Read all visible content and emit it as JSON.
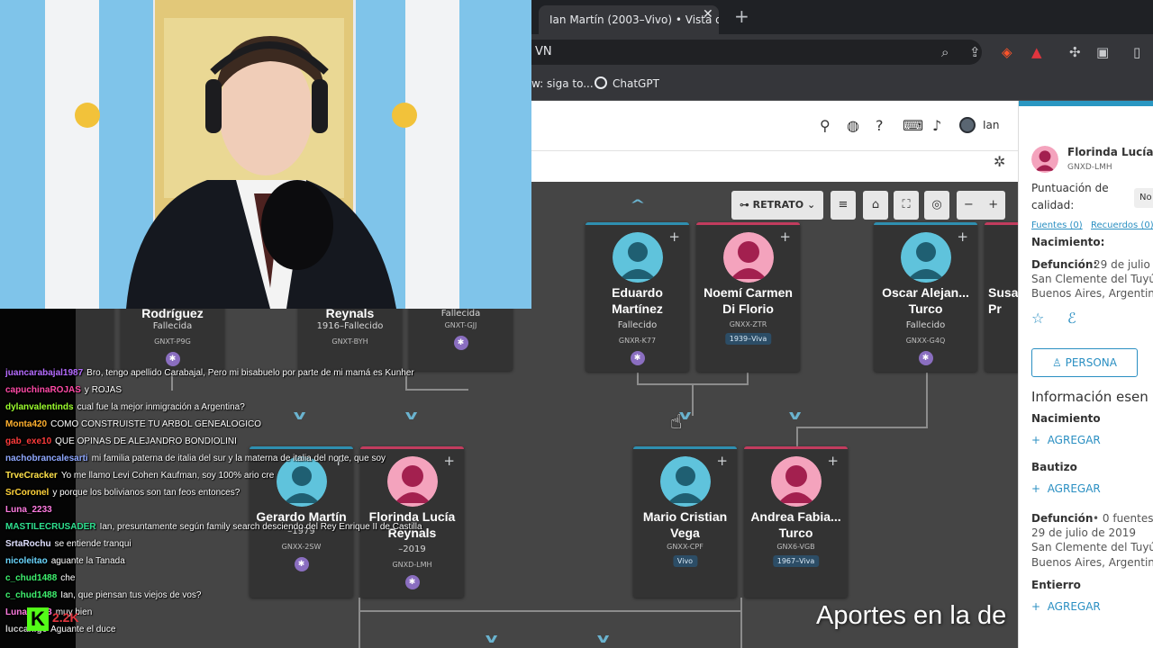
{
  "browser": {
    "tab_title": "Ian Martín (2003–Vivo) • Vista de",
    "tab_close": "✕",
    "new_tab": "+",
    "url_fragment": "VN",
    "bookmarks": [
      "w: siga to...",
      "ChatGPT"
    ]
  },
  "site_header": {
    "user_name": "Ian"
  },
  "tree": {
    "view_mode": "RETRATO",
    "top_row": [
      {
        "name": "Eduardo Martínez",
        "status": "Fallecido",
        "id": "GNXR-K77",
        "gender": "male"
      },
      {
        "name": "Noemí Carmen Di Florio",
        "id": "GNXX-ZTR",
        "badge": "1939–Viva",
        "gender": "female"
      },
      {
        "name": "Oscar Alejan... Turco",
        "status": "Fallecido",
        "id": "GNXX-G4Q",
        "gender": "male"
      },
      {
        "name": "Susa... Pr",
        "gender": "female"
      }
    ],
    "top_row_partial": [
      {
        "name": "Rodríguez",
        "status": "Fallecida",
        "id": "GNXT-P9G"
      },
      {
        "name": "Reynals",
        "status": "1916–Fallecido",
        "id": "GNXT-BYH"
      },
      {
        "status": "Fallecida",
        "id": "GNXT-GJJ"
      }
    ],
    "mid_row": [
      {
        "name": "Gerardo Martín",
        "dates": "–1979",
        "id": "GNXX-2SW",
        "gender": "male"
      },
      {
        "name": "Florinda Lucía Reynals",
        "dates": "–2019",
        "id": "GNXD-LMH",
        "gender": "female"
      },
      {
        "name": "Mario Cristian Vega",
        "id": "GNXX-CPF",
        "badge": "Vivo",
        "gender": "male"
      },
      {
        "name": "Andrea Fabia... Turco",
        "id": "GNX6-VGB",
        "badge": "1967–Viva",
        "gender": "female"
      }
    ]
  },
  "panel": {
    "name": "Florinda Lucía R",
    "id": "GNXD-LMH",
    "quality_label_1": "Puntuación de",
    "quality_label_2": "calidad:",
    "quality_value": "No",
    "sources_link": "Fuentes (0)",
    "memories_link": "Recuerdos (0)",
    "birth_label": "Nacimiento:",
    "death_label": "Defunción:",
    "death_date": "29 de julio d",
    "death_place_1": "San Clemente del Tuyú,",
    "death_place_2": "Buenos Aires, Argentina",
    "person_button": "PERSONA",
    "section_title": "Información esen",
    "vital_birth": "Nacimiento",
    "add": "AGREGAR",
    "vital_baptism": "Bautizo",
    "vital_death": "Defunción",
    "vital_death_sources": "• 0 fuentes",
    "vital_death_date": "29 de julio de 2019",
    "vital_death_place_1": "San Clemente del Tuyú,",
    "vital_death_place_2": "Buenos Aires, Argentina",
    "vital_burial": "Entierro"
  },
  "chat": [
    {
      "user": "juancarabajal1987",
      "color": "#b56bff",
      "text": "Bro, tengo apellido Carabajal, Pero mi bisabuelo por parte de mi mamá es Kunher"
    },
    {
      "user": "capuchinaROJAS",
      "color": "#ff4aa6",
      "text": "y ROJAS"
    },
    {
      "user": "dylanvalentinds",
      "color": "#9cff2e",
      "text": "cual fue la mejor inmigración a Argentina?"
    },
    {
      "user": "Monta420",
      "color": "#ffb02e",
      "text": "COMO CONSTRUISTE TU ARBOL GENEALOGICO"
    },
    {
      "user": "gab_exe10",
      "color": "#ff3b3b",
      "text": "QUE OPINAS DE ALEJANDRO BONDIOLINI"
    },
    {
      "user": "nachobrancalesarti",
      "color": "#8fa8ff",
      "text": "mi familia paterna de italia del sur y la materna de italia del norte, que soy"
    },
    {
      "user": "TrveCracker",
      "color": "#ffe24a",
      "text": "Yo me llamo Levi Cohen Kaufman, soy 100% ario cre"
    },
    {
      "user": "SrCoronel",
      "color": "#ffd23a",
      "text": "y porque los bolivianos son tan feos entonces?"
    },
    {
      "user": "Luna_2233",
      "color": "#ff7be0",
      "text": ""
    },
    {
      "user": "MASTILECRUSADER",
      "color": "#2ee08f",
      "text": "Ian, presuntamente según family search desciendo del Rey Enrique II de Castilla"
    },
    {
      "user": "SrtaRochu",
      "color": "#e0e0ff",
      "text": "se entiende tranqui"
    },
    {
      "user": "nicoleitao",
      "color": "#6ad7ff",
      "text": "aguante la Tanada"
    },
    {
      "user": "c_chud1488",
      "color": "#3ef06e",
      "text": "che"
    },
    {
      "user": "c_chud1488",
      "color": "#3ef06e",
      "text": "Ian, que piensan tus viejos de vos?"
    },
    {
      "user": "Luna_2233",
      "color": "#ff7be0",
      "text": "muy bien"
    },
    {
      "user": "luccanige",
      "color": "#c8c8c8",
      "text": "Aguante el duce"
    }
  ],
  "kick": {
    "logo": "K",
    "count": "2.2K"
  },
  "overlay_text": "Aportes en la de",
  "colors": {
    "male": "#2f8fb0",
    "female": "#c23c5e",
    "accent": "#2a8fc2",
    "kick": "#53fc18"
  }
}
